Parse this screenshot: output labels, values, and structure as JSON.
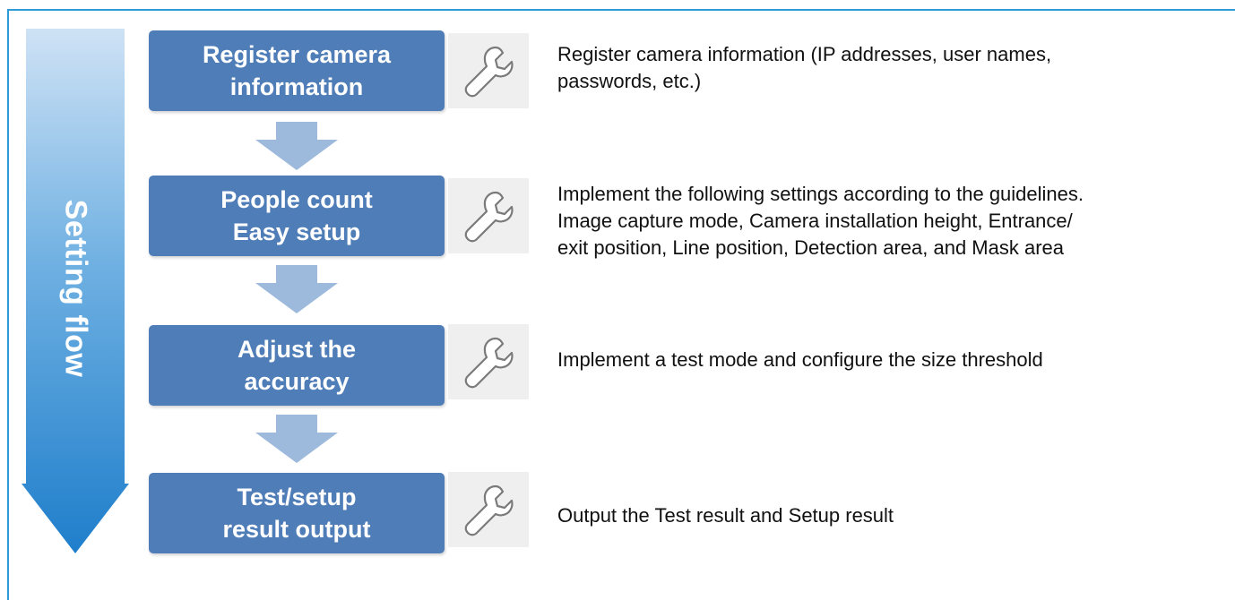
{
  "flow": {
    "label": "Setting flow",
    "arrow_color_top": "#c8def3",
    "arrow_color_bottom": "#1f7ecb"
  },
  "colors": {
    "frame_border": "#2e9ad6",
    "step_box": "#4f7db8",
    "connector_arrow": "#9db9dc",
    "tool_tile": "#efefef"
  },
  "steps": [
    {
      "title_lines": [
        "Register camera",
        "information"
      ],
      "icon": "wrench-icon",
      "description_lines": [
        "Register camera information (IP addresses, user names,",
        "passwords, etc.)"
      ]
    },
    {
      "title_lines": [
        "People count",
        "Easy setup"
      ],
      "icon": "wrench-icon",
      "description_lines": [
        "Implement the following settings according to the guidelines.",
        "Image capture mode, Camera installation height, Entrance/",
        "exit position, Line position, Detection area, and Mask area"
      ]
    },
    {
      "title_lines": [
        "Adjust the",
        "accuracy"
      ],
      "icon": "wrench-icon",
      "description_lines": [
        "Implement a test mode and configure the size threshold"
      ]
    },
    {
      "title_lines": [
        "Test/setup",
        "result output"
      ],
      "icon": "wrench-icon",
      "description_lines": [
        "Output the Test result and Setup result"
      ]
    }
  ]
}
